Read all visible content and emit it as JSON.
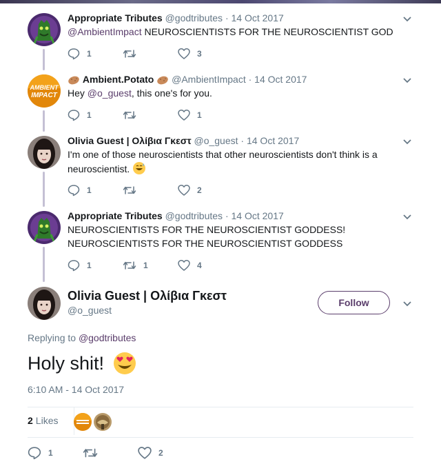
{
  "thread": [
    {
      "name": "Appropriate Tributes",
      "handle": "@godtributes",
      "date": "· 14 Oct 2017",
      "mention": "@AmbientImpact",
      "text": " NEUROSCIENTISTS FOR THE NEUROSCIENTIST GOD",
      "replies": "1",
      "retweets": "",
      "likes": "3",
      "avatar_icon": "green-demon-avatar"
    },
    {
      "name": "Ambient.Potato",
      "handle": "@AmbientImpact",
      "date": "· 14 Oct 2017",
      "text_before": "Hey ",
      "mention": "@o_guest",
      "text_after": ", this one's for you.",
      "replies": "1",
      "retweets": "",
      "likes": "1",
      "avatar_icon": "ambient-impact-logo",
      "avatar_text": [
        "AMBIENT",
        "IMPACT"
      ]
    },
    {
      "name": "Olivia Guest | Ολίβια Γκεστ",
      "handle": "@o_guest",
      "date": "· 14 Oct 2017",
      "text": "I'm one of those neuroscientists that other neuroscientists don't think is a neuroscientist.",
      "replies": "1",
      "retweets": "",
      "likes": "2",
      "avatar_icon": "olivia-portrait-avatar"
    },
    {
      "name": "Appropriate Tributes",
      "handle": "@godtributes",
      "date": "· 14 Oct 2017",
      "text_line1": "NEUROSCIENTISTS FOR THE NEUROSCIENTIST GODDESS!",
      "text_line2": "NEUROSCIENTISTS FOR THE NEUROSCIENTIST GODDESS",
      "replies": "1",
      "retweets": "1",
      "likes": "4",
      "avatar_icon": "green-demon-avatar"
    }
  ],
  "main": {
    "name": "Olivia Guest | Ολίβια Γκεστ",
    "handle": "@o_guest",
    "follow_label": "Follow",
    "replying_prefix": "Replying to ",
    "replying_to": "@godtributes",
    "text": "Holy shit!",
    "timestamp": "6:10 AM - 14 Oct 2017",
    "likes_count": "2",
    "likes_label": "Likes",
    "replies": "1",
    "retweets": "",
    "likes": "2"
  },
  "colors": {
    "accent": "#5a3d6b",
    "muted": "#657786",
    "text": "#14171a",
    "divider": "#e6ecf0"
  }
}
